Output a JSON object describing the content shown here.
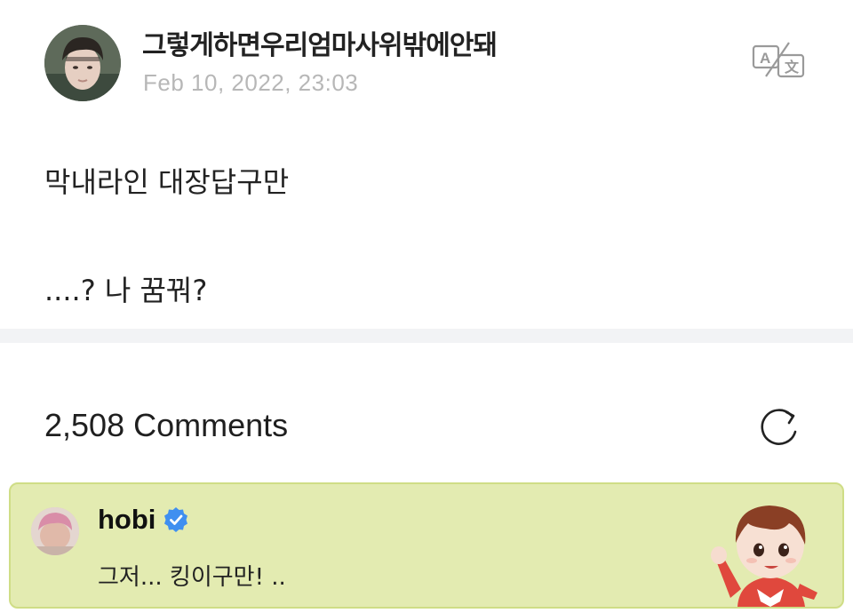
{
  "post": {
    "author_name": "그렇게하면우리엄마사위밖에안돼",
    "date": "Feb 10, 2022, 23:03",
    "body_line_1": "막내라인 대장답구만",
    "body_line_2": "....? 나 꿈꿔?"
  },
  "icons": {
    "translate": "translate-icon",
    "refresh": "refresh-icon",
    "verified": "verified-badge-icon"
  },
  "comments": {
    "count_label": "2,508 Comments"
  },
  "featured_comment": {
    "author": "hobi",
    "text": "그저... 킹이구만! ..",
    "background_color": "#e3ebb1",
    "border_color": "#cfdd86"
  },
  "colors": {
    "date_gray": "#b7b7b7",
    "divider": "#f2f3f5",
    "verified_blue": "#3f8ff0"
  }
}
